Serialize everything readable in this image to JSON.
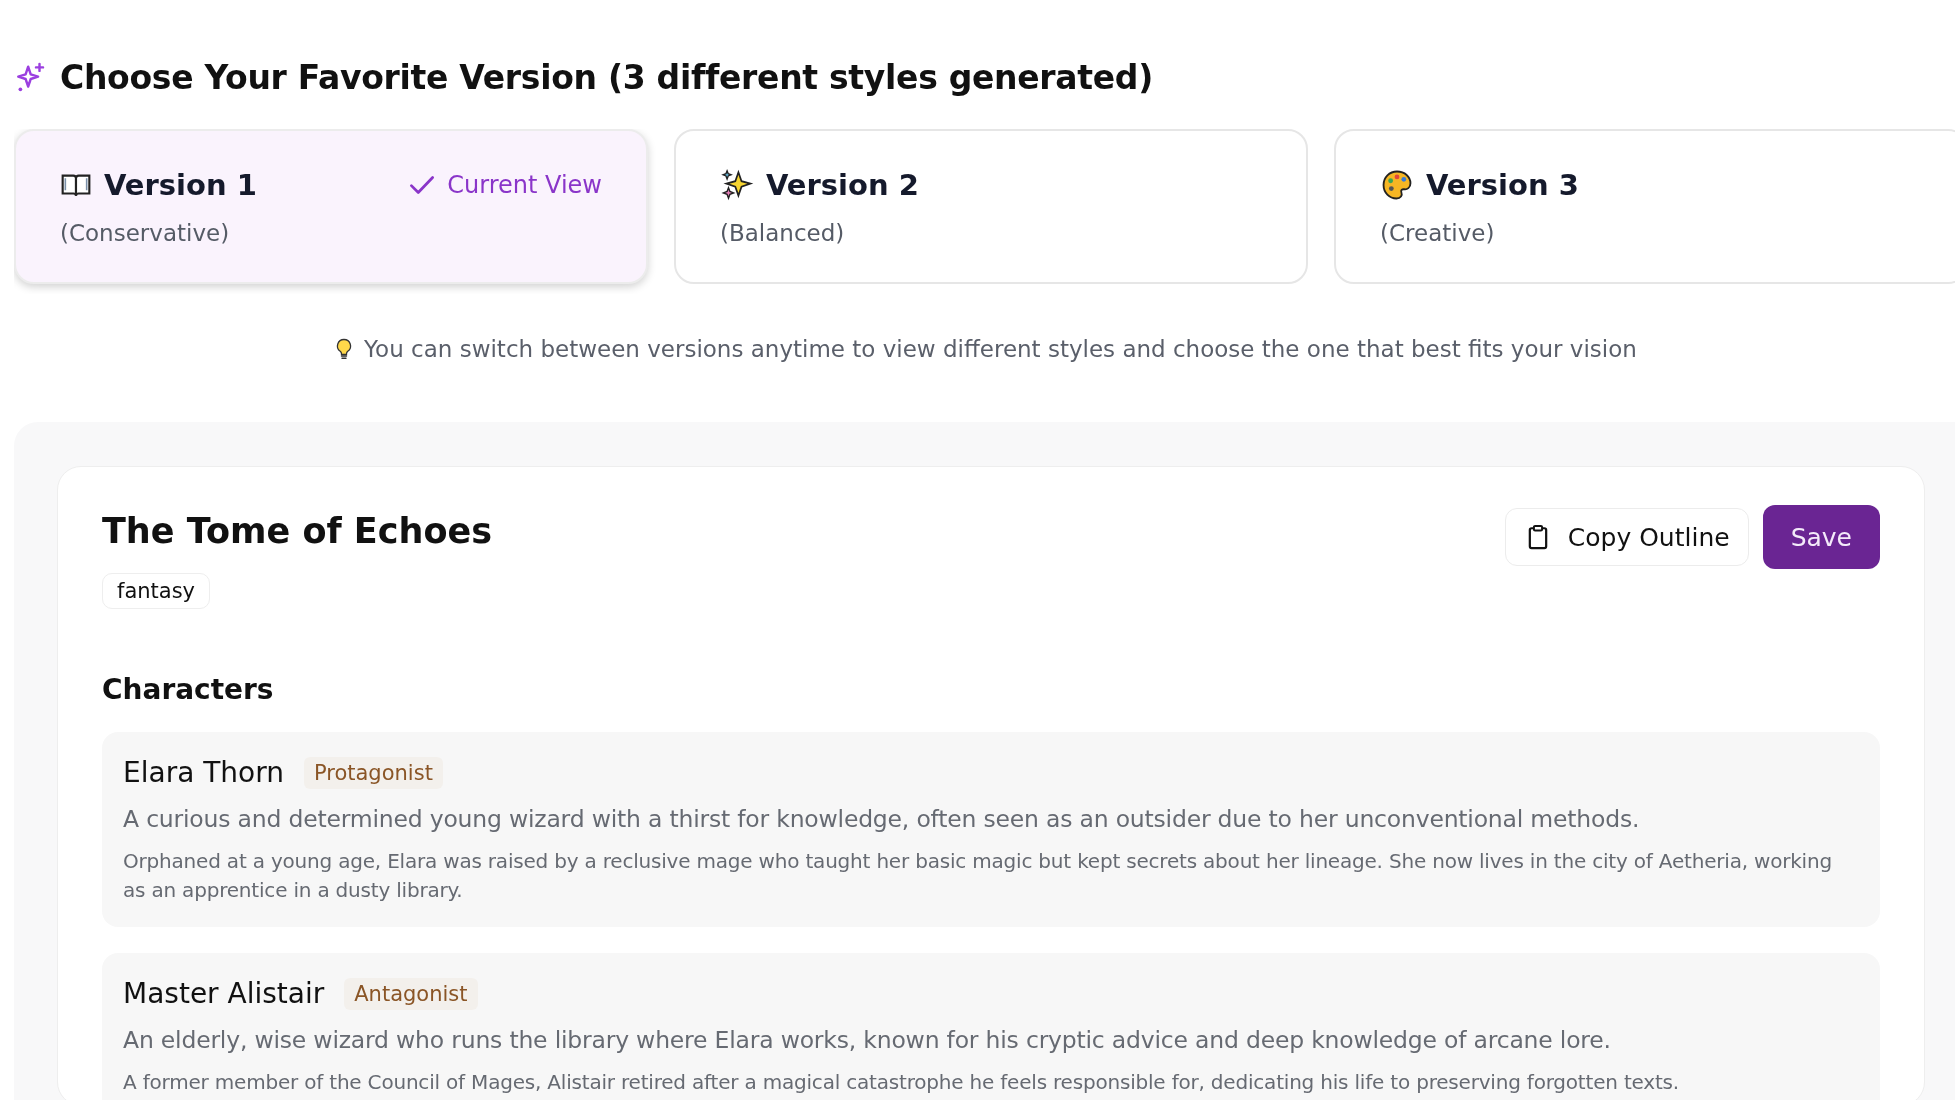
{
  "heading": {
    "title": "Choose Your Favorite Version (3 different styles generated)"
  },
  "versions": [
    {
      "label": "Version 1",
      "style": "(Conservative)",
      "selected": true,
      "current_label": "Current View"
    },
    {
      "label": "Version 2",
      "style": "(Balanced)",
      "selected": false
    },
    {
      "label": "Version 3",
      "style": "(Creative)",
      "selected": false
    }
  ],
  "tip": "You can switch between versions anytime to view different styles and choose the one that best fits your vision",
  "outline": {
    "title": "The Tome of Echoes",
    "genre": "fantasy",
    "buttons": [
      {
        "kind": "copy",
        "label": "Copy Outline"
      },
      {
        "kind": "save",
        "label": "Save"
      }
    ],
    "section_title": "Characters",
    "characters": [
      {
        "name": "Elara Thorn",
        "role": "Protagonist",
        "description": "A curious and determined young wizard with a thirst for knowledge, often seen as an outsider due to her unconventional methods.",
        "backstory": "Orphaned at a young age, Elara was raised by a reclusive mage who taught her basic magic but kept secrets about her lineage. She now lives in the city of Aetheria, working as an apprentice in a dusty library."
      },
      {
        "name": "Master Alistair",
        "role": "Antagonist",
        "description": "An elderly, wise wizard who runs the library where Elara works, known for his cryptic advice and deep knowledge of arcane lore.",
        "backstory": "A former member of the Council of Mages, Alistair retired after a magical catastrophe he feels responsible for, dedicating his life to preserving forgotten texts."
      }
    ]
  }
}
